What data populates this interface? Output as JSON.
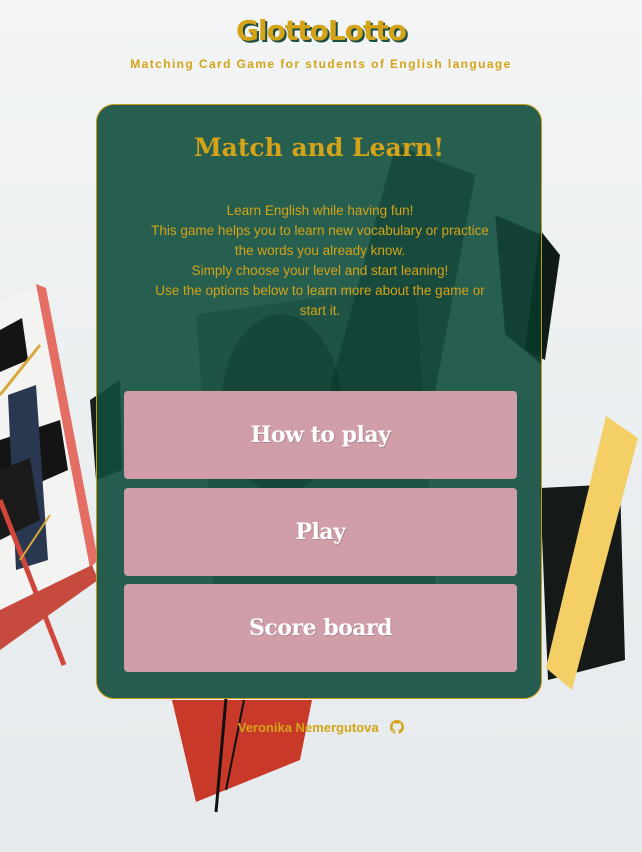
{
  "header": {
    "title": "GlottoLotto",
    "subtitle": "Matching Card Game for students of English language"
  },
  "card": {
    "title": "Match and Learn!",
    "intro_lines": [
      "Learn English while having fun!",
      "This game helps you to learn new vocabulary or practice the words you already know.",
      "Simply choose your level and start leaning!",
      "Use the options below to learn more about the game or start it."
    ]
  },
  "menu": {
    "how_to_play": "How to play",
    "play": "Play",
    "score_board": "Score board"
  },
  "footer": {
    "author": "Veronika Nemergutova",
    "icon": "github-icon"
  },
  "colors": {
    "accent": "#d4a317",
    "card_bg": "#104e3e",
    "button_bg": "#d09ea9",
    "button_text": "#ffffff"
  }
}
